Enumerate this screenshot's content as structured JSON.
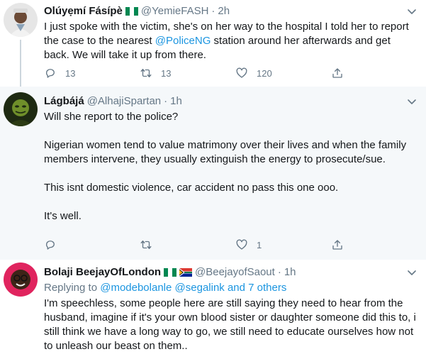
{
  "tweets": [
    {
      "name": "Olúyẹmí Fásípè",
      "handle": "@YemieFASH",
      "time": "2h",
      "flags": [
        "ng"
      ],
      "text_parts": [
        "I just spoke with the victim, she's on her way to the hospital I told her to report the case to the nearest ",
        "@PoliceNG",
        " station around her afterwards and get back. We will take it up from there."
      ],
      "reply_count": "13",
      "retweet_count": "13",
      "like_count": "120"
    },
    {
      "name": "Lágbájá",
      "handle": "@AlhajiSpartan",
      "time": "1h",
      "paragraphs": [
        "Will she report to the police?",
        "Nigerian women tend to value matrimony over their lives and when the family members intervene, they usually extinguish the energy to prosecute/sue.",
        "This isnt domestic violence, car accident no pass this one ooo.",
        "It's well."
      ],
      "reply_count": "",
      "retweet_count": "",
      "like_count": "1"
    },
    {
      "name": "Bolaji BeejayOfLondon",
      "handle": "@BeejayofSaout",
      "time": "1h",
      "flags": [
        "ng",
        "za"
      ],
      "replying_prefix": "Replying to",
      "replying_mention_1": "@modebolanle",
      "replying_mention_2": "@segalink",
      "replying_suffix": "and 7 others",
      "text": "I'm speechless, some people here are still saying they need to hear from the husband, imagine if it's your own blood sister or daughter someone did this to, i still think we have a long way to go, we still need to educate ourselves how not to unleash our beast on them.."
    }
  ],
  "icons": {
    "reply": "reply-icon",
    "retweet": "retweet-icon",
    "like": "heart-icon",
    "share": "share-icon",
    "more": "chevron-down-icon"
  },
  "colors": {
    "link": "#1b95e0",
    "secondary_text": "#657786",
    "highlight_bg": "#f5f8fa",
    "thread_line": "#ccd6dd"
  }
}
